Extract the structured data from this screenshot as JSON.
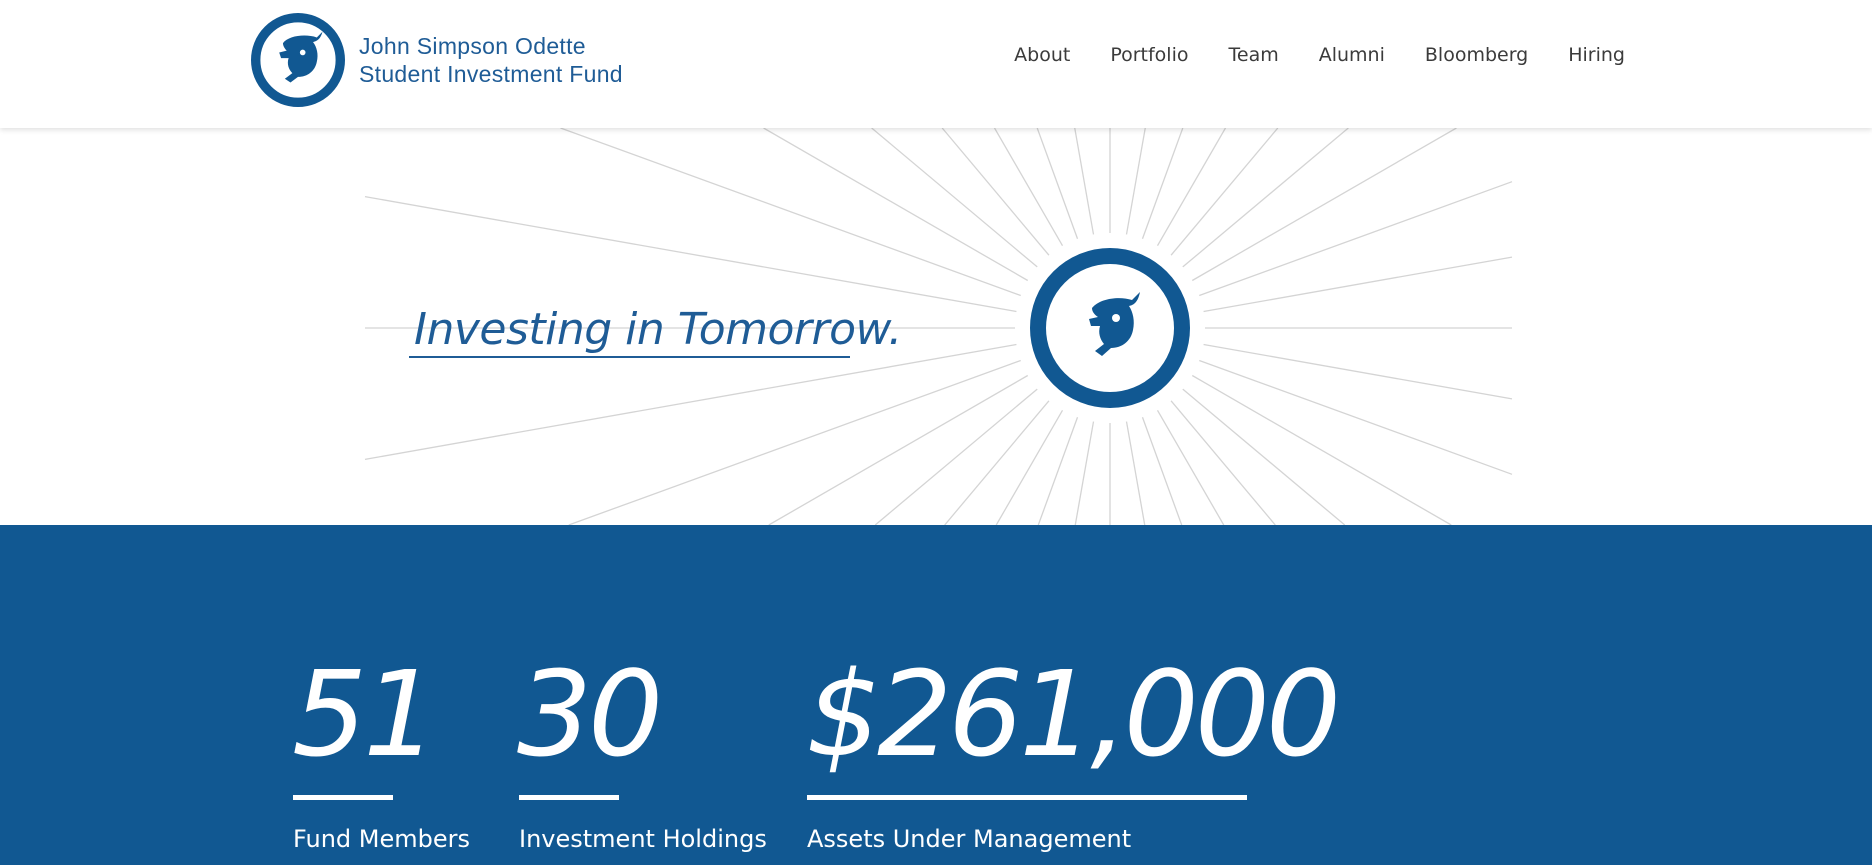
{
  "brand": {
    "name_line1": "John Simpson Odette",
    "name_line2": "Student Investment Fund",
    "logo_icon": "bull-head-icon",
    "color": "#1f5c96"
  },
  "nav": {
    "items": [
      {
        "label": "About"
      },
      {
        "label": "Portfolio"
      },
      {
        "label": "Team"
      },
      {
        "label": "Alumni"
      },
      {
        "label": "Bloomberg"
      },
      {
        "label": "Hiring"
      }
    ]
  },
  "hero": {
    "tagline": "Investing in Tomorrow.",
    "emblem_icon": "bull-head-icon",
    "ray_color": "#d4d4d4"
  },
  "stats": {
    "background": "#115892",
    "items": [
      {
        "value": "51",
        "label": "Fund Members"
      },
      {
        "value": "30",
        "label": "Investment Holdings"
      },
      {
        "value": "$261,000",
        "label": "Assets Under Management"
      }
    ]
  }
}
